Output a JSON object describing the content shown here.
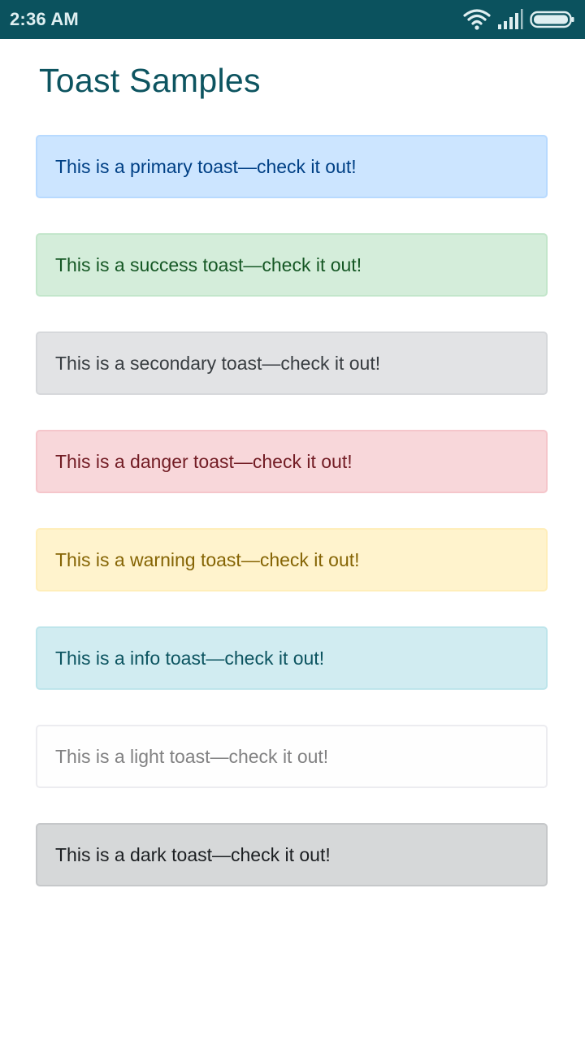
{
  "status_bar": {
    "time": "2:36 AM",
    "icons": [
      "wifi-icon",
      "signal-icon",
      "battery-icon"
    ]
  },
  "page": {
    "title": "Toast Samples"
  },
  "toasts": [
    {
      "variant": "primary",
      "text": "This is a primary toast—check it out!",
      "bg": "#cce5ff",
      "border": "#b8daff",
      "color": "#004085"
    },
    {
      "variant": "success",
      "text": "This is a success toast—check it out!",
      "bg": "#d4edda",
      "border": "#c3e6cb",
      "color": "#155724"
    },
    {
      "variant": "secondary",
      "text": "This is a secondary toast—check it out!",
      "bg": "#e2e3e5",
      "border": "#d6d8db",
      "color": "#383d41"
    },
    {
      "variant": "danger",
      "text": "This is a danger toast—check it out!",
      "bg": "#f8d7da",
      "border": "#f5c6cb",
      "color": "#721c24"
    },
    {
      "variant": "warning",
      "text": "This is a warning toast—check it out!",
      "bg": "#fff3cd",
      "border": "#ffeeba",
      "color": "#856404"
    },
    {
      "variant": "info",
      "text": "This is a info toast—check it out!",
      "bg": "#d1ecf1",
      "border": "#bee5eb",
      "color": "#0c5460"
    },
    {
      "variant": "light",
      "text": "This is a light toast—check it out!",
      "bg": "#fefefe",
      "border": "#ececf0",
      "color": "#818182"
    },
    {
      "variant": "dark",
      "text": "This is a dark toast—check it out!",
      "bg": "#d6d8d9",
      "border": "#c6c8ca",
      "color": "#1b1e21"
    }
  ]
}
